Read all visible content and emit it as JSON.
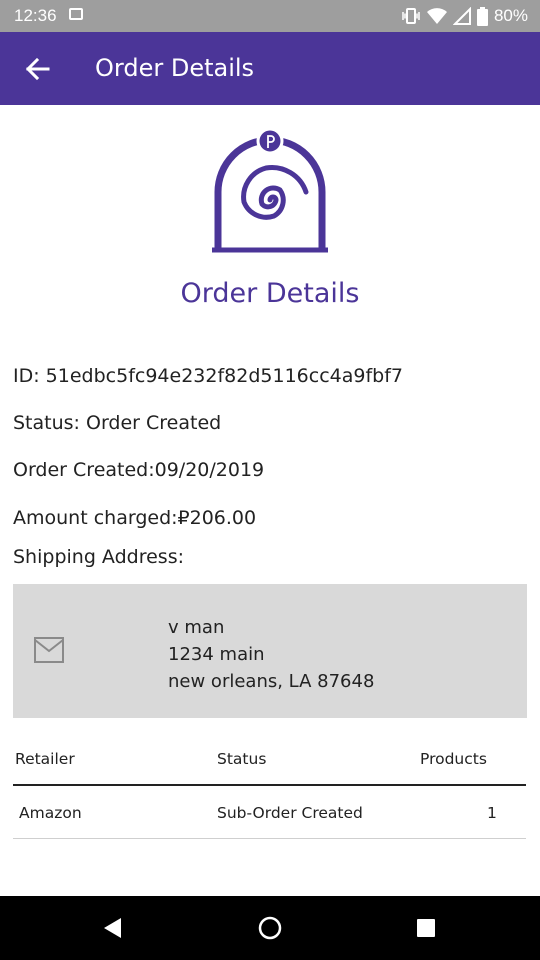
{
  "status_bar": {
    "time": "12:36",
    "battery": "80%"
  },
  "app_bar": {
    "title": "Order Details"
  },
  "page": {
    "heading": "Order Details",
    "accent_color": "#4b3598"
  },
  "order": {
    "id_text": "ID: 51edbc5fc94e232f82d5116cc4a9fbf7",
    "status_text": "Status: Order Created",
    "created_text": "Order Created:09/20/2019",
    "amount_text": "Amount charged:₽206.00",
    "shipping_label": "Shipping Address:"
  },
  "address": {
    "name": "v man",
    "street": "1234 main",
    "city_line": "new orleans, LA 87648"
  },
  "suborders": {
    "headers": [
      "Retailer",
      "Status",
      "Products"
    ],
    "rows": [
      [
        "Amazon",
        "Sub-Order Created",
        "1"
      ]
    ]
  }
}
